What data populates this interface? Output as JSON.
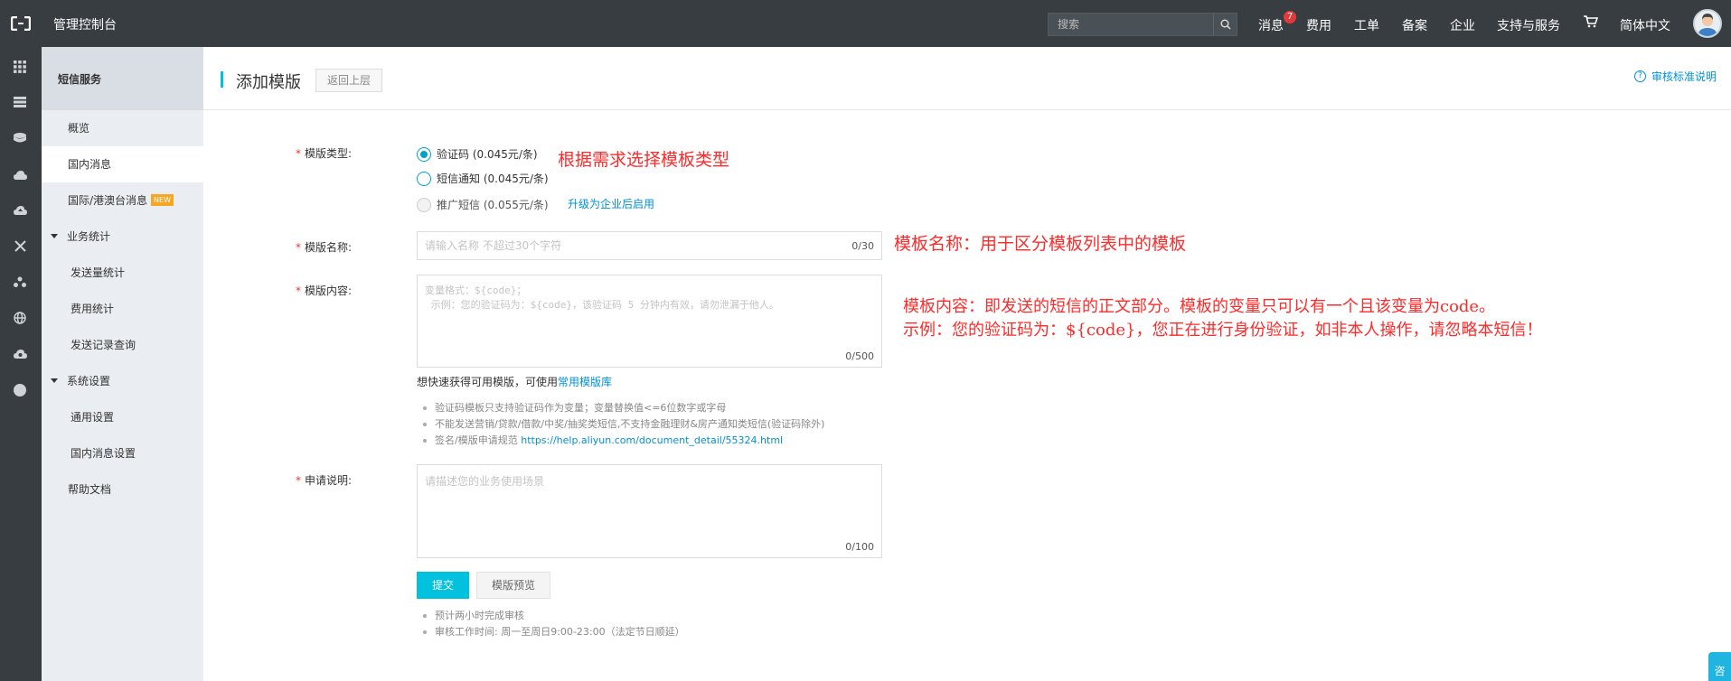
{
  "topbar": {
    "console_title": "管理控制台",
    "search_placeholder": "搜索",
    "nav": [
      {
        "label": "消息",
        "badge": "7"
      },
      {
        "label": "费用"
      },
      {
        "label": "工单"
      },
      {
        "label": "备案"
      },
      {
        "label": "企业"
      },
      {
        "label": "支持与服务"
      },
      {
        "label": "简体中文"
      }
    ],
    "cart_icon": "cart-icon"
  },
  "rail_icons": [
    "grid-icon",
    "server-icon",
    "database-icon",
    "cloud-icon",
    "cloud-upload-icon",
    "network-icon",
    "cluster-icon",
    "globe-icon",
    "cloud-settings-icon",
    "circle-icon"
  ],
  "sidebar": {
    "title": "短信服务",
    "items": [
      {
        "label": "概览"
      },
      {
        "label": "国内消息"
      },
      {
        "label": "国际/港澳台消息",
        "tag": "NEW"
      },
      {
        "label": "业务统计"
      },
      {
        "label": "发送量统计"
      },
      {
        "label": "费用统计"
      },
      {
        "label": "发送记录查询"
      },
      {
        "label": "系统设置"
      },
      {
        "label": "通用设置"
      },
      {
        "label": "国内消息设置"
      },
      {
        "label": "帮助文档"
      }
    ]
  },
  "header": {
    "title": "添加模版",
    "back_label": "返回上层",
    "help_label": "审核标准说明",
    "help_glyph": "?"
  },
  "form": {
    "required_mark": "*",
    "type_label": "模版类型:",
    "type_options": [
      {
        "label": "验证码 (0.045元/条)",
        "checked": true
      },
      {
        "label": "短信通知 (0.045元/条)",
        "checked": false
      },
      {
        "label": "推广短信 (0.055元/条)",
        "checked": false,
        "disabled": true
      }
    ],
    "upgrade_link": "升级为企业后启用",
    "name_label": "模版名称:",
    "name_placeholder": "请输入名称 不超过30个字符",
    "name_counter": "0/30",
    "content_label": "模版内容:",
    "content_placeholder": "变量格式：${code}；\n 示例：您的验证码为：${code}，该验证码 5 分钟内有效，请勿泄漏于他人。",
    "content_counter": "0/500",
    "template_hint": "想快速获得可用模版，可使用",
    "template_hint_link": "常用模版库",
    "rules": [
      "验证码模板只支持验证码作为变量；变量替换值<=6位数字或字母",
      "不能发送营销/贷款/借款/中奖/抽奖类短信,不支持金融理财&房产通知类短信(验证码除外)",
      "签名/模版申请规范"
    ],
    "rules_link": "https://help.aliyun.com/document_detail/55324.html",
    "remark_label": "申请说明:",
    "remark_placeholder": "请描述您的业务使用场景",
    "remark_counter": "0/100",
    "submit_label": "提交",
    "preview_label": "模版预览",
    "footer_notes": [
      "预计两小时完成审核",
      "审核工作时间: 周一至周日9:00-23:00（法定节日顺延）"
    ]
  },
  "annotations": {
    "type": "根据需求选择模板类型",
    "name": "模板名称：用于区分模板列表中的模板",
    "content_line1": "模板内容：即发送的短信的正文部分。模板的变量只可以有一个且该变量为code。",
    "content_line2": "示例：您的验证码为：${code}，您正在进行身份验证，如非本人操作，请忽略本短信！"
  },
  "float_widget": {
    "label": "咨"
  },
  "colors": {
    "topbar": "#373d41",
    "accent": "#00c1de",
    "link": "#0091d6",
    "annotation": "#ff2a2a",
    "badge": "#e4393c"
  }
}
